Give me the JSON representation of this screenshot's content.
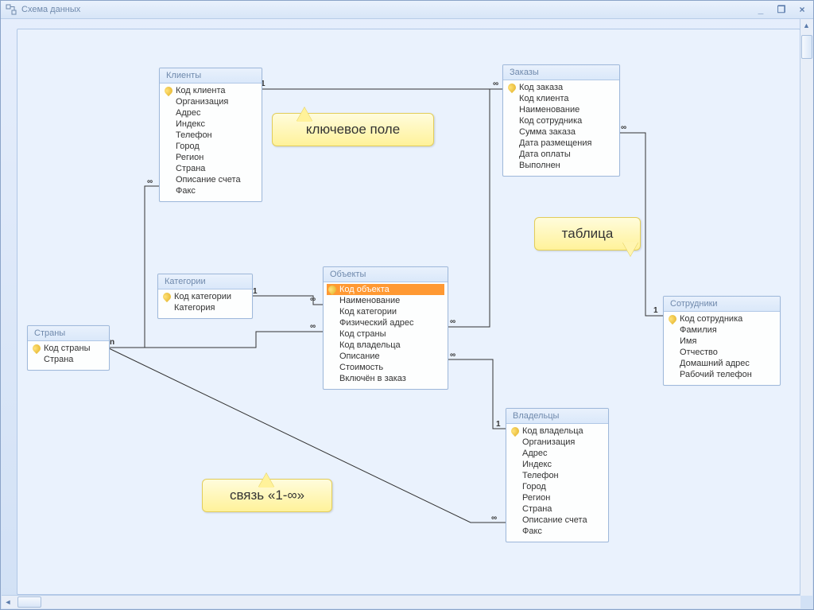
{
  "window": {
    "title": "Схема данных",
    "min": "_",
    "restore": "❐",
    "close": "×"
  },
  "callouts": {
    "keyfield": "ключевое поле",
    "table": "таблица",
    "relation": "связь «1-∞»"
  },
  "cardinality": {
    "one": "1",
    "many": "∞",
    "n": "n"
  },
  "tables": {
    "clients": {
      "title": "Клиенты",
      "fields": [
        "Код клиента",
        "Организация",
        "Адрес",
        "Индекс",
        "Телефон",
        "Город",
        "Регион",
        "Страна",
        "Описание счета",
        "Факс"
      ],
      "pk": [
        0
      ]
    },
    "orders": {
      "title": "Заказы",
      "fields": [
        "Код заказа",
        "Код клиента",
        "Наименование",
        "Код сотрудника",
        "Сумма заказа",
        "Дата размещения",
        "Дата оплаты",
        "Выполнен"
      ],
      "pk": [
        0
      ]
    },
    "countries": {
      "title": "Страны",
      "fields": [
        "Код страны",
        "Страна"
      ],
      "pk": [
        0
      ]
    },
    "categories": {
      "title": "Категории",
      "fields": [
        "Код категории",
        "Категория"
      ],
      "pk": [
        0
      ]
    },
    "objects": {
      "title": "Объекты",
      "fields": [
        "Код объекта",
        "Наименование",
        "Код категории",
        "Физический адрес",
        "Код страны",
        "Код владельца",
        "Описание",
        "Стоимость",
        "Включён в заказ"
      ],
      "pk": [
        0
      ],
      "selected": 0
    },
    "employees": {
      "title": "Сотрудники",
      "fields": [
        "Код сотрудника",
        "Фамилия",
        "Имя",
        "Отчество",
        "Домашний адрес",
        "Рабочий телефон"
      ],
      "pk": [
        0
      ]
    },
    "owners": {
      "title": "Владельцы",
      "fields": [
        "Код владельца",
        "Организация",
        "Адрес",
        "Индекс",
        "Телефон",
        "Город",
        "Регион",
        "Страна",
        "Описание счета",
        "Факс"
      ],
      "pk": [
        0
      ]
    }
  }
}
